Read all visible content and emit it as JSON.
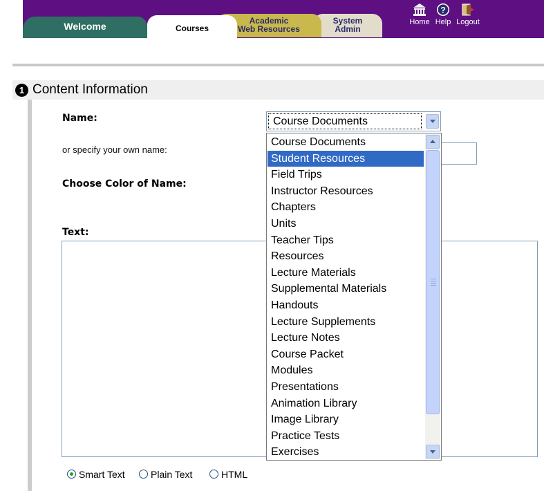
{
  "nav": {
    "tabs": [
      {
        "label": "Welcome"
      },
      {
        "label": "Courses"
      },
      {
        "label_line1": "Academic",
        "label_line2": "Web Resources"
      },
      {
        "label_line1": "System",
        "label_line2": "Admin"
      }
    ],
    "icons": [
      {
        "label": "Home",
        "icon": "home-icon"
      },
      {
        "label": "Help",
        "icon": "help-icon"
      },
      {
        "label": "Logout",
        "icon": "logout-icon"
      }
    ],
    "bar_color": "#5e1083"
  },
  "section": {
    "step": "1",
    "title": "Content Information"
  },
  "form": {
    "name_label": "Name:",
    "own_name_label": "or specify your own name:",
    "color_label": "Choose Color of Name:",
    "text_label": "Text:",
    "name_select_value": "Course Documents",
    "name_options": [
      "Course Documents",
      "Student Resources",
      "Field Trips",
      "Instructor Resources",
      "Chapters",
      "Units",
      "Teacher Tips",
      "Resources",
      "Lecture Materials",
      "Supplemental Materials",
      "Handouts",
      "Lecture Supplements",
      "Lecture Notes",
      "Course Packet",
      "Modules",
      "Presentations",
      "Animation Library",
      "Image Library",
      "Practice Tests",
      "Exercises"
    ],
    "highlighted_option": "Student Resources",
    "text_format": {
      "options": [
        "Smart Text",
        "Plain Text",
        "HTML"
      ],
      "selected": "Smart Text"
    }
  }
}
